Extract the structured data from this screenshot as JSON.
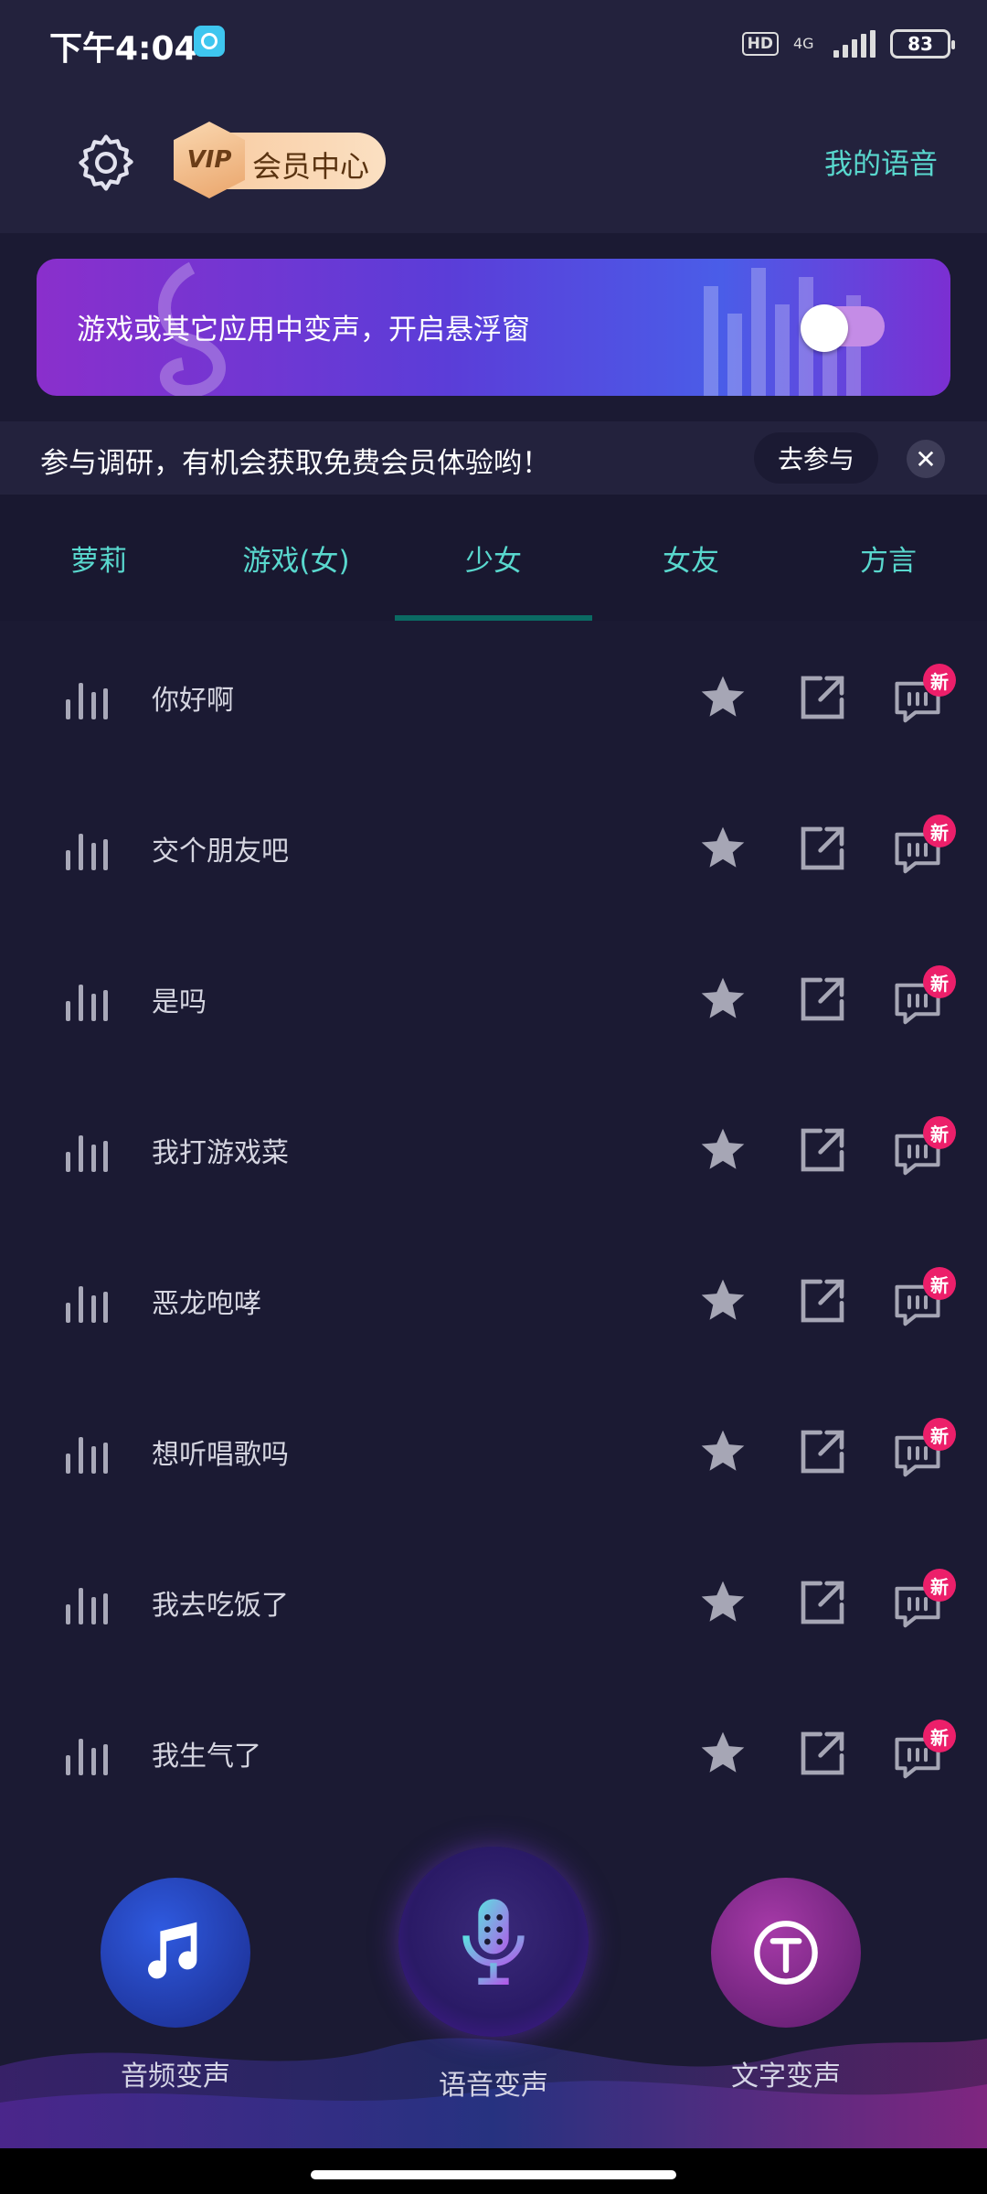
{
  "status_bar": {
    "time": "下午4:04",
    "hd": "HD",
    "network": "4G",
    "battery": "83"
  },
  "header": {
    "vip_badge": "VIP",
    "vip_label": "会员中心",
    "my_voice": "我的语音"
  },
  "float_banner": {
    "text": "游戏或其它应用中变声，开启悬浮窗",
    "toggle_on": false
  },
  "survey": {
    "text": "参与调研，有机会获取免费会员体验哟！",
    "join": "去参与",
    "close": "✕"
  },
  "tabs": [
    {
      "label": "萝莉",
      "active": false
    },
    {
      "label": "游戏(女)",
      "active": false
    },
    {
      "label": "少女",
      "active": true
    },
    {
      "label": "女友",
      "active": false
    },
    {
      "label": "方言",
      "active": false
    }
  ],
  "voice_list": [
    {
      "text": "你好啊",
      "badge": "新"
    },
    {
      "text": "交个朋友吧",
      "badge": "新"
    },
    {
      "text": "是吗",
      "badge": "新"
    },
    {
      "text": "我打游戏菜",
      "badge": "新"
    },
    {
      "text": "恶龙咆哮",
      "badge": "新"
    },
    {
      "text": "想听唱歌吗",
      "badge": "新"
    },
    {
      "text": "我去吃饭了",
      "badge": "新"
    },
    {
      "text": "我生气了",
      "badge": "新"
    }
  ],
  "bottom_nav": {
    "audio": "音频变声",
    "voice": "语音变声",
    "text": "文字变声"
  },
  "colors": {
    "accent": "#59d8ce",
    "background": "#1b1a33",
    "badge": "#ec1f6a"
  }
}
